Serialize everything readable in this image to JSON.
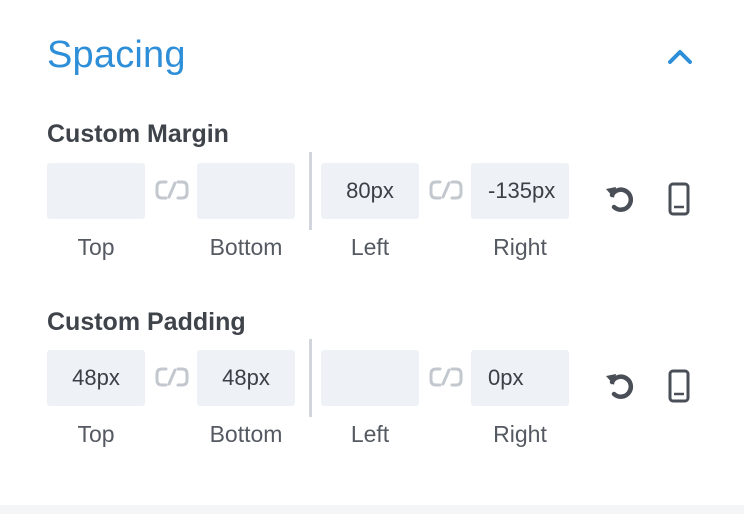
{
  "section": {
    "title": "Spacing"
  },
  "margin": {
    "label": "Custom Margin",
    "fields": [
      {
        "label": "Top",
        "value": ""
      },
      {
        "label": "Bottom",
        "value": ""
      },
      {
        "label": "Left",
        "value": "80px"
      },
      {
        "label": "Right",
        "value": "-135px"
      }
    ]
  },
  "padding": {
    "label": "Custom Padding",
    "fields": [
      {
        "label": "Top",
        "value": "48px"
      },
      {
        "label": "Bottom",
        "value": "48px"
      },
      {
        "label": "Left",
        "value": ""
      },
      {
        "label": "Right",
        "value": "0px"
      }
    ]
  },
  "icons": {
    "collapse": "chevron-up-icon",
    "link": "link-icon",
    "reset": "undo-icon",
    "responsive": "mobile-icon"
  },
  "colors": {
    "accent": "#2e8fd8",
    "field_bg": "#eef1f6",
    "label": "#3f434a",
    "icon": "#4a4f57",
    "link_icon": "#c3c8cf"
  }
}
